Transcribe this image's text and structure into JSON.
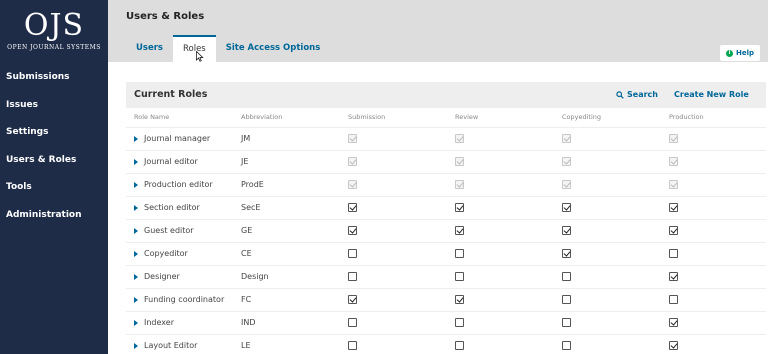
{
  "sidebar": {
    "logo_mark": "OJS",
    "logo_sub": "OPEN JOURNAL SYSTEMS",
    "items": [
      {
        "label": "Submissions",
        "name": "submissions"
      },
      {
        "label": "Issues",
        "name": "issues"
      },
      {
        "label": "Settings",
        "name": "settings"
      },
      {
        "label": "Users & Roles",
        "name": "users-roles"
      },
      {
        "label": "Tools",
        "name": "tools"
      },
      {
        "label": "Administration",
        "name": "administration"
      }
    ]
  },
  "header": {
    "title": "Users & Roles",
    "tabs": [
      {
        "label": "Users",
        "name": "users",
        "active": false
      },
      {
        "label": "Roles",
        "name": "roles",
        "active": true
      },
      {
        "label": "Site Access Options",
        "name": "site-access-options",
        "active": false
      }
    ],
    "help_label": "Help"
  },
  "panel": {
    "title": "Current Roles",
    "search_label": "Search",
    "create_label": "Create New Role",
    "columns": [
      "Role Name",
      "Abbreviation",
      "Submission",
      "Review",
      "Copyediting",
      "Production"
    ],
    "rows": [
      {
        "name": "Journal manager",
        "abbr": "JM",
        "checks": [
          true,
          true,
          true,
          true
        ],
        "disabled": true
      },
      {
        "name": "Journal editor",
        "abbr": "JE",
        "checks": [
          true,
          true,
          true,
          true
        ],
        "disabled": true
      },
      {
        "name": "Production editor",
        "abbr": "ProdE",
        "checks": [
          true,
          true,
          true,
          true
        ],
        "disabled": true
      },
      {
        "name": "Section editor",
        "abbr": "SecE",
        "checks": [
          true,
          true,
          true,
          true
        ],
        "disabled": false
      },
      {
        "name": "Guest editor",
        "abbr": "GE",
        "checks": [
          true,
          true,
          true,
          true
        ],
        "disabled": false
      },
      {
        "name": "Copyeditor",
        "abbr": "CE",
        "checks": [
          false,
          false,
          true,
          false
        ],
        "disabled": false
      },
      {
        "name": "Designer",
        "abbr": "Design",
        "checks": [
          false,
          false,
          false,
          true
        ],
        "disabled": false
      },
      {
        "name": "Funding coordinator",
        "abbr": "FC",
        "checks": [
          true,
          true,
          false,
          false
        ],
        "disabled": false
      },
      {
        "name": "Indexer",
        "abbr": "IND",
        "checks": [
          false,
          false,
          false,
          true
        ],
        "disabled": false
      },
      {
        "name": "Layout Editor",
        "abbr": "LE",
        "checks": [
          false,
          false,
          false,
          true
        ],
        "disabled": false
      }
    ]
  },
  "colors": {
    "sidebar_bg": "#1e2c48",
    "link": "#006798",
    "help_icon": "#00a650"
  }
}
